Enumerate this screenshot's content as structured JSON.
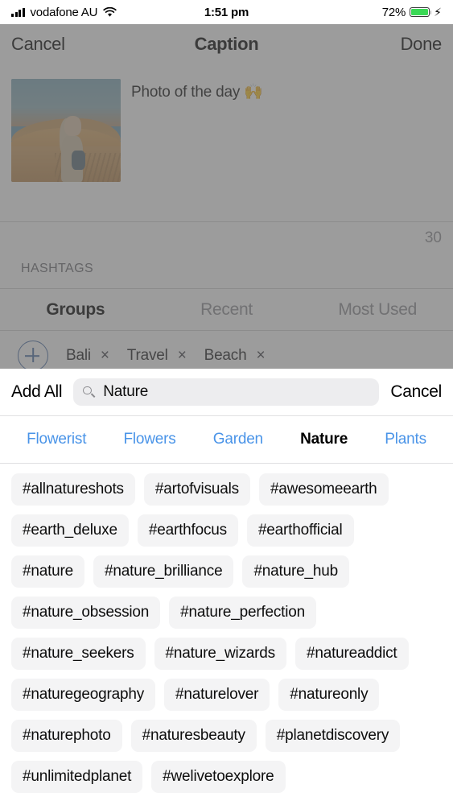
{
  "status_bar": {
    "carrier": "vodafone AU",
    "time": "1:51 pm",
    "battery_percent": "72%",
    "signal_icon": "cellular-bars-icon",
    "wifi_icon": "wifi-icon",
    "battery_icon": "battery-icon",
    "charging_icon": "lightning-bolt-icon",
    "battery_color": "#3ad955"
  },
  "nav_bar": {
    "cancel_label": "Cancel",
    "title": "Caption",
    "done_label": "Done"
  },
  "caption": {
    "text": "Photo of the day",
    "emoji": "🙌",
    "thumbnail_alt": "desert-photo-thumbnail",
    "char_counter": "30"
  },
  "hashtags_section": {
    "label": "HASHTAGS",
    "tabs": [
      {
        "label": "Groups",
        "active": true
      },
      {
        "label": "Recent",
        "active": false
      },
      {
        "label": "Most Used",
        "active": false
      }
    ],
    "add_group_icon": "plus-circle-icon",
    "groups": [
      {
        "name": "Bali",
        "remove": "×"
      },
      {
        "name": "Travel",
        "remove": "×"
      },
      {
        "name": "Beach",
        "remove": "×"
      }
    ]
  },
  "sheet": {
    "add_all_label": "Add All",
    "search": {
      "icon": "search-icon",
      "value": "Nature",
      "placeholder": "Search"
    },
    "cancel_label": "Cancel",
    "categories": [
      {
        "label": "Flowerist",
        "active": false
      },
      {
        "label": "Flowers",
        "active": false
      },
      {
        "label": "Garden",
        "active": false
      },
      {
        "label": "Nature",
        "active": true
      },
      {
        "label": "Plants",
        "active": false
      }
    ],
    "category_link_color": "#4a94e8",
    "tag_rows": [
      [
        "#allnatureshots",
        "#artofvisuals",
        "#awesomeearth"
      ],
      [
        "#earth_deluxe",
        "#earthfocus",
        "#earthofficial"
      ],
      [
        "#nature",
        "#nature_brilliance",
        "#nature_hub"
      ],
      [
        "#nature_obsession",
        "#nature_perfection"
      ],
      [
        "#nature_seekers",
        "#nature_wizards",
        "#natureaddict"
      ],
      [
        "#naturegeography",
        "#naturelover",
        "#natureonly"
      ],
      [
        "#naturephoto",
        "#naturesbeauty",
        "#planetdiscovery"
      ],
      [
        "#unlimitedplanet",
        "#welivetoexplore"
      ]
    ]
  }
}
